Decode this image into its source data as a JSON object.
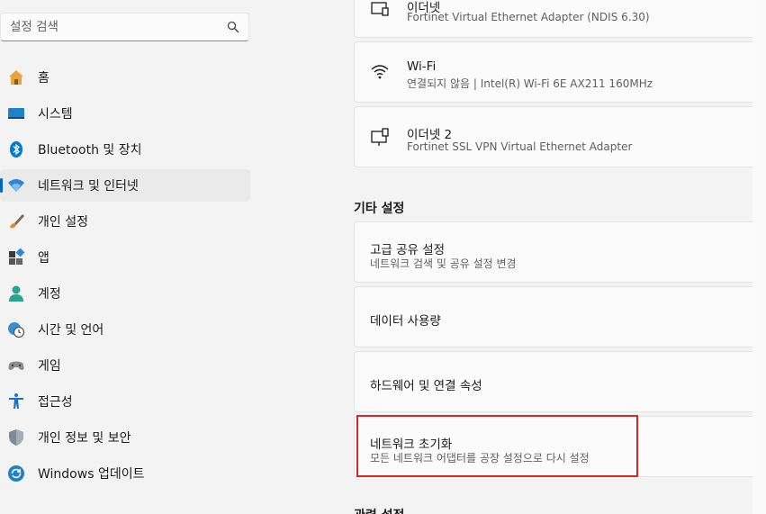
{
  "search": {
    "placeholder": "설정 검색"
  },
  "nav": {
    "items": [
      {
        "label": "홈",
        "icon": "home-icon"
      },
      {
        "label": "시스템",
        "icon": "system-icon"
      },
      {
        "label": "Bluetooth 및 장치",
        "icon": "bluetooth-icon"
      },
      {
        "label": "네트워크 및 인터넷",
        "icon": "network-icon",
        "active": true
      },
      {
        "label": "개인 설정",
        "icon": "brush-icon"
      },
      {
        "label": "앱",
        "icon": "apps-icon"
      },
      {
        "label": "계정",
        "icon": "account-icon"
      },
      {
        "label": "시간 및 언어",
        "icon": "clock-globe-icon"
      },
      {
        "label": "게임",
        "icon": "gamepad-icon"
      },
      {
        "label": "접근성",
        "icon": "accessibility-icon"
      },
      {
        "label": "개인 정보 및 보안",
        "icon": "shield-icon"
      },
      {
        "label": "Windows 업데이트",
        "icon": "update-icon"
      }
    ]
  },
  "adapters": [
    {
      "title": "이더넷",
      "subtitle": "Fortinet Virtual Ethernet Adapter (NDIS 6.30)",
      "icon": "ethernet-icon"
    },
    {
      "title": "Wi-Fi",
      "subtitle": "연결되지 않음 | Intel(R) Wi-Fi 6E AX211 160MHz",
      "icon": "wifi-icon"
    },
    {
      "title": "이더넷 2",
      "subtitle": "Fortinet SSL VPN Virtual Ethernet Adapter",
      "icon": "ethernet-icon"
    }
  ],
  "other_settings": {
    "title": "기타 설정",
    "items": [
      {
        "title": "고급 공유 설정",
        "subtitle": "네트워크 검색 및 공유 설정 변경"
      },
      {
        "title": "데이터 사용량",
        "subtitle": ""
      },
      {
        "title": "하드웨어 및 연결 속성",
        "subtitle": ""
      },
      {
        "title": "네트워크 초기화",
        "subtitle": "모든 네트워크 어댑터를 공장 설정으로 다시 설정"
      }
    ]
  },
  "next_section": {
    "title": "관련 설정"
  },
  "colors": {
    "accent": "#0067c0",
    "highlight": "#d9262b"
  }
}
